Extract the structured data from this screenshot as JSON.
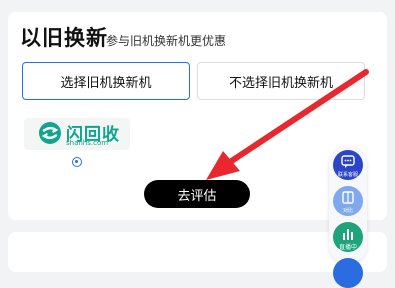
{
  "section": {
    "title": "以旧换新",
    "subtitle": "参与旧机换新机更优惠"
  },
  "options": {
    "select_label": "选择旧机换新机",
    "deselect_label": "不选择旧机换新机",
    "selected": "选择旧机换新机"
  },
  "partner": {
    "name": "闪回收",
    "url": "shanhs.com"
  },
  "actions": {
    "evaluate_label": "去评估"
  },
  "floating": {
    "contact_label": "联系客服",
    "compare_label": "对比",
    "live_label": "直播中"
  },
  "colors": {
    "accent": "#1a73e8",
    "brand": "#0fa58f",
    "annotation": "#e8272e"
  }
}
